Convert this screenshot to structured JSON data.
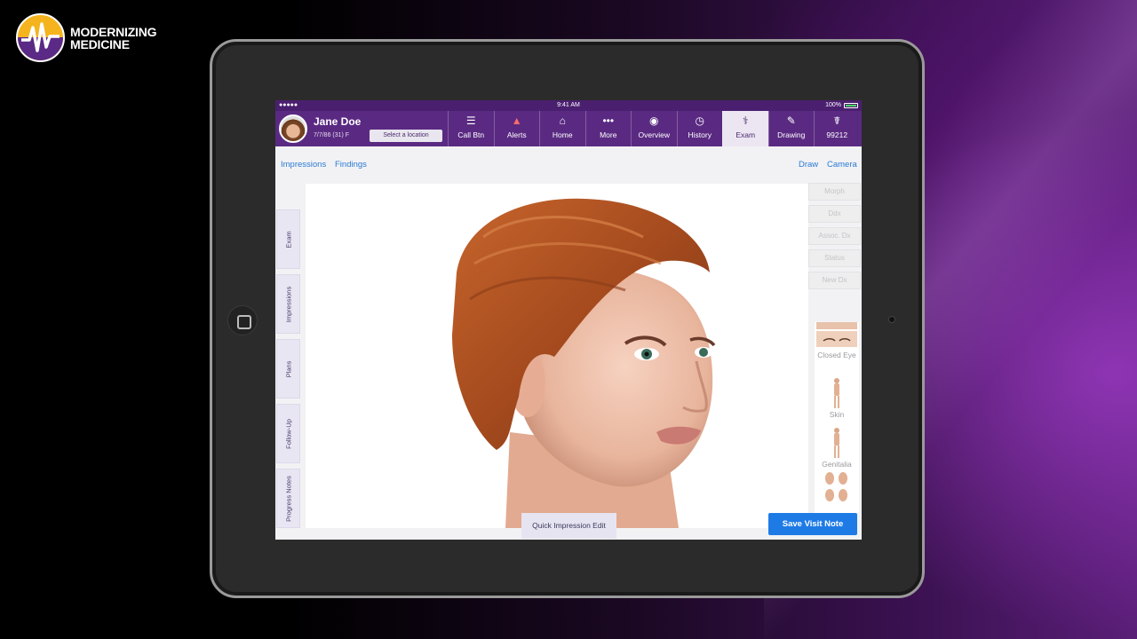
{
  "brand": {
    "line1": "MODERNIZING",
    "line2": "MEDICINE"
  },
  "status": {
    "signal": "●●●●● ",
    "time": "9:41 AM",
    "battery": "100%"
  },
  "patient": {
    "name": "Jane Doe",
    "dob": "7/7/86 (31) F",
    "location_button": "Select a location"
  },
  "nav": [
    {
      "label": "Call Btn",
      "icon": "list-icon",
      "glyph": "☰"
    },
    {
      "label": "Alerts",
      "icon": "bell-icon",
      "glyph": "🔔"
    },
    {
      "label": "Home",
      "icon": "home-icon",
      "glyph": "⌂"
    },
    {
      "label": "More",
      "icon": "more-icon",
      "glyph": "•••"
    },
    {
      "label": "Overview",
      "icon": "person-icon",
      "glyph": "◉"
    },
    {
      "label": "History",
      "icon": "clock-icon",
      "glyph": "◷"
    },
    {
      "label": "Exam",
      "icon": "stethoscope-icon",
      "glyph": "⚕",
      "active": true
    },
    {
      "label": "Drawing",
      "icon": "pencil-icon",
      "glyph": "✎"
    },
    {
      "label": "99212",
      "icon": "billing-icon",
      "glyph": "☤"
    }
  ],
  "subbar": {
    "impressions": "Impressions",
    "findings": "Findings",
    "draw": "Draw",
    "camera": "Camera"
  },
  "side_tabs": [
    "Exam",
    "Impressions",
    "Plans",
    "Follow-Up",
    "Progress Notes"
  ],
  "right_buttons": [
    "Morph",
    "Ddx",
    "Assoc. Dx",
    "Status",
    "New Dx"
  ],
  "thumbnails": {
    "closed_eye": "Closed Eye",
    "skin": "Skin",
    "genitalia": "Genitalia"
  },
  "quick_edit": "Quick Impression Edit",
  "save_button": "Save Visit Note",
  "colors": {
    "nav_purple": "#5a2a82",
    "accent_blue": "#1e7be6",
    "logo_yellow": "#f5b41e"
  }
}
